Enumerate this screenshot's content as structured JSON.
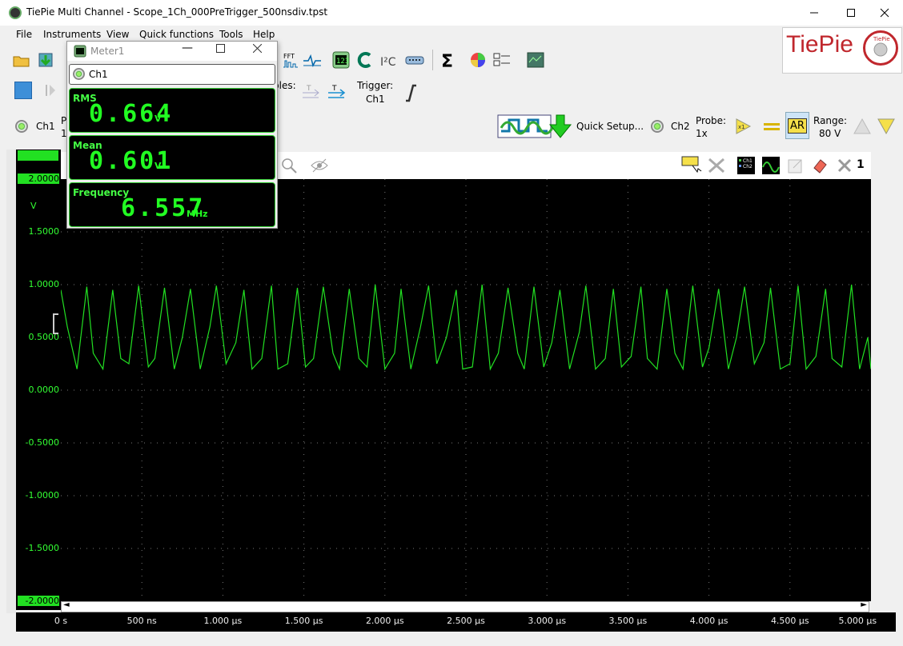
{
  "window": {
    "title": "TiePie Multi Channel - Scope_1Ch_000PreTrigger_500nsdiv.tpst"
  },
  "menu": [
    "File",
    "Instruments",
    "View",
    "Quick functions",
    "Tools",
    "Help"
  ],
  "logo": {
    "text": "TiePie",
    "badge": "TiePie",
    "badge_sub": "engineering"
  },
  "toolbar": {
    "fft_label": "FFT",
    "samples_label": "ples:",
    "trigger_label": "Trigger:",
    "trigger_source": "Ch1"
  },
  "ch1": {
    "name": "Ch1",
    "probe_partial": "P",
    "value_partial": "1"
  },
  "ch2": {
    "name": "Ch2",
    "probe_label": "Probe:",
    "probe_value": "1x",
    "ar_label": "AR",
    "range_label": "Range:",
    "range_value": "80 V"
  },
  "quick_setup": "Quick Setup...",
  "meter": {
    "title": "Meter1",
    "channel": "Ch1",
    "panels": [
      {
        "label": "RMS",
        "value": "0.664",
        "unit": "V"
      },
      {
        "label": "Mean",
        "value": "0.601",
        "unit": "V"
      },
      {
        "label": "Frequency",
        "value": "6.557",
        "unit": "MHz"
      }
    ]
  },
  "scope": {
    "cursor_count": "1",
    "unit": "V"
  },
  "colors": {
    "trace": "#22e022",
    "axis_text": "#33ff33",
    "logo_red": "#c0272d",
    "background": "#000000"
  },
  "chart_data": {
    "type": "line",
    "title": "",
    "xlabel": "",
    "ylabel": "V",
    "y_ticks": [
      "2.0000",
      "1.5000",
      "1.0000",
      "0.5000",
      "0.0000",
      "-0.5000",
      "-1.0000",
      "-1.5000",
      "-2.0000"
    ],
    "x_ticks": [
      "0 s",
      "500 ns",
      "1.000 µs",
      "1.500 µs",
      "2.000 µs",
      "2.500 µs",
      "3.000 µs",
      "3.500 µs",
      "4.000 µs",
      "4.500 µs",
      "5.000 µs"
    ],
    "xlim_us": [
      0,
      5
    ],
    "ylim": [
      -2,
      2
    ],
    "grid": true,
    "series": [
      {
        "frequency_mhz": 6.557,
        "max_v": 1.0,
        "min_v": 0.2,
        "mean_v": 0.601,
        "x_us": [
          0.0,
          0.04,
          0.1,
          0.16,
          0.2,
          0.26,
          0.32,
          0.37,
          0.42,
          0.48,
          0.54,
          0.58,
          0.64,
          0.7,
          0.75,
          0.8,
          0.86,
          0.92,
          0.96,
          1.02,
          1.08,
          1.13,
          1.18,
          1.24,
          1.3,
          1.34,
          1.4,
          1.46,
          1.51,
          1.56,
          1.62,
          1.68,
          1.72,
          1.78,
          1.84,
          1.89,
          1.94,
          2.0,
          2.06,
          2.1,
          2.16,
          2.22,
          2.27,
          2.32,
          2.38,
          2.44,
          2.48,
          2.54,
          2.6,
          2.65,
          2.7,
          2.76,
          2.82,
          2.86,
          2.92,
          2.98,
          3.03,
          3.08,
          3.14,
          3.2,
          3.24,
          3.3,
          3.36,
          3.41,
          3.46,
          3.52,
          3.58,
          3.62,
          3.68,
          3.74,
          3.79,
          3.84,
          3.9,
          3.96,
          4.0,
          4.06,
          4.12,
          4.17,
          4.22,
          4.28,
          4.34,
          4.38,
          4.44,
          4.5,
          4.55,
          4.6,
          4.66,
          4.72,
          4.76,
          4.82,
          4.88,
          4.93,
          4.98,
          5.0
        ],
        "y_v": [
          0.95,
          0.6,
          0.2,
          0.98,
          0.35,
          0.2,
          0.95,
          0.3,
          0.25,
          0.99,
          0.22,
          0.3,
          0.97,
          0.2,
          0.5,
          0.96,
          0.2,
          0.6,
          0.99,
          0.25,
          0.45,
          0.95,
          0.2,
          0.3,
          0.99,
          0.2,
          0.25,
          0.97,
          0.22,
          0.3,
          0.98,
          0.35,
          0.2,
          0.96,
          0.3,
          0.22,
          1.0,
          0.2,
          0.35,
          0.96,
          0.2,
          0.6,
          0.99,
          0.25,
          0.5,
          0.95,
          0.2,
          0.22,
          1.0,
          0.2,
          0.35,
          0.97,
          0.35,
          0.2,
          0.98,
          0.22,
          0.45,
          0.95,
          0.2,
          0.55,
          0.99,
          0.2,
          0.3,
          0.96,
          0.22,
          0.32,
          0.98,
          0.3,
          0.2,
          0.96,
          0.35,
          0.2,
          0.99,
          0.22,
          0.4,
          0.96,
          0.2,
          0.5,
          0.98,
          0.25,
          0.45,
          0.97,
          0.2,
          0.25,
          0.99,
          0.2,
          0.32,
          0.96,
          0.3,
          0.22,
          1.0,
          0.2,
          0.5,
          0.2
        ]
      }
    ]
  }
}
